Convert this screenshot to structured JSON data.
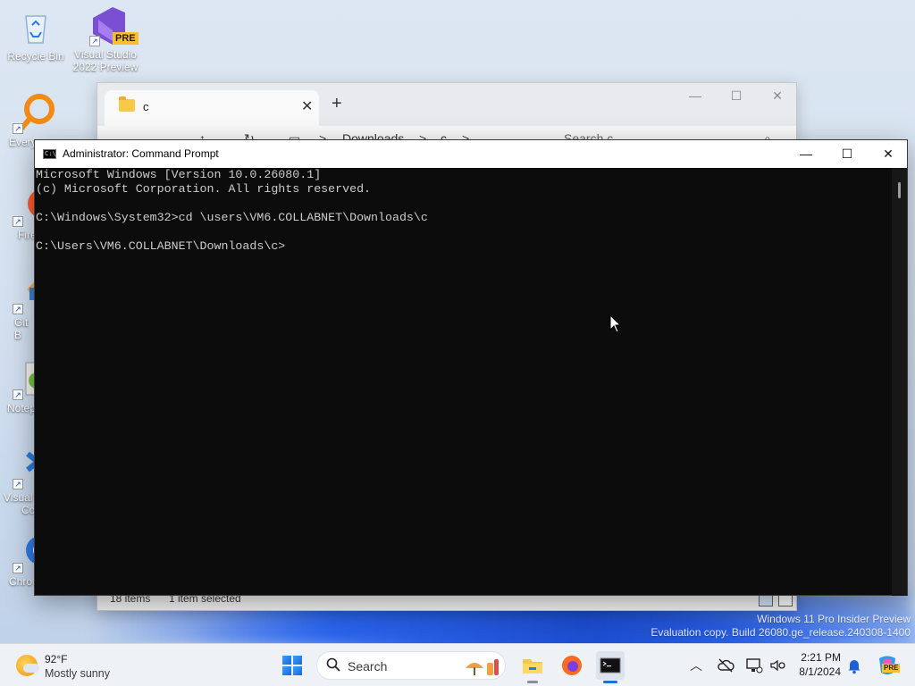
{
  "desktop": {
    "icons": [
      {
        "label": "Recycle Bin"
      },
      {
        "label": "Visual Studio 2022 Preview",
        "badge": "PRE"
      },
      {
        "label": "Every"
      },
      {
        "label": "Fire"
      },
      {
        "label": "Git B"
      },
      {
        "label": "Notep"
      },
      {
        "label": "Visual",
        "label2": "Co"
      },
      {
        "label": "Chro"
      }
    ]
  },
  "explorer": {
    "tab_title": "c",
    "new_tab_glyph": "+",
    "toolbar": {
      "crumb1": "Downloads",
      "sep": ">",
      "crumb2": "c",
      "search_placeholder": "Search c"
    },
    "status": {
      "items": "18 items",
      "selected": "1 item selected"
    }
  },
  "cmd": {
    "title": "Administrator: Command Prompt",
    "icon_text": "C:\\",
    "lines": [
      "Microsoft Windows [Version 10.0.26080.1]",
      "(c) Microsoft Corporation. All rights reserved.",
      "",
      "C:\\Windows\\System32>cd \\users\\VM6.COLLABNET\\Downloads\\c",
      "",
      "C:\\Users\\VM6.COLLABNET\\Downloads\\c>"
    ]
  },
  "watermark": {
    "line1": "Windows 11 Pro Insider Preview",
    "line2": "Evaluation copy. Build 26080.ge_release.240308-1400"
  },
  "taskbar": {
    "weather": {
      "temp": "92°F",
      "condition": "Mostly sunny"
    },
    "search_label": "Search",
    "clock": {
      "time": "2:21 PM",
      "date": "8/1/2024"
    },
    "copilot_badge": "PRE"
  }
}
